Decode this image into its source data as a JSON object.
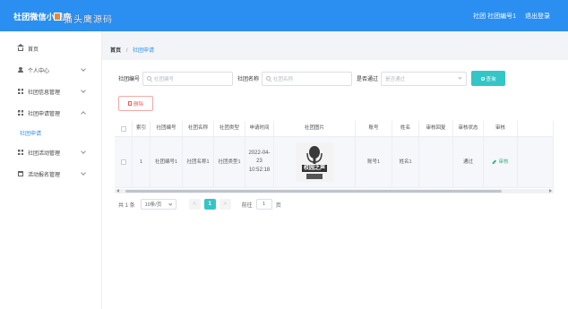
{
  "header": {
    "title": "社团微信小程序",
    "watermark": "猫头鹰源码",
    "user_label": "社团 社团编号1",
    "logout_label": "退出登录"
  },
  "sidebar": {
    "items": [
      {
        "label": "首页",
        "icon": "home-icon"
      },
      {
        "label": "个人中心",
        "icon": "user-icon"
      },
      {
        "label": "社团信息管理",
        "icon": "grid-icon"
      },
      {
        "label": "社团申请管理",
        "icon": "grid-icon"
      },
      {
        "label": "社团申请",
        "icon": ""
      },
      {
        "label": "社团活动管理",
        "icon": "grid-icon"
      },
      {
        "label": "活动报名管理",
        "icon": "calendar-icon"
      }
    ]
  },
  "breadcrumb": {
    "home": "首页",
    "separator": "/",
    "current": "社团申请"
  },
  "search": {
    "club_number_label": "社团编号",
    "club_number_placeholder": "社团编号",
    "club_name_label": "社团名称",
    "club_name_placeholder": "社团名称",
    "approved_label": "是否通过",
    "approved_placeholder": "是否通过",
    "search_button": "查询"
  },
  "actions": {
    "delete_button": "删除"
  },
  "table": {
    "columns": [
      "索引",
      "社团编号",
      "社团名称",
      "社团类型",
      "申请时间",
      "社团图片",
      "账号",
      "姓名",
      "审核回复",
      "审核状态",
      "审核"
    ],
    "rows": [
      {
        "index": "1",
        "club_number": "社团编号1",
        "club_name": "社团名称1",
        "club_type": "社团类型1",
        "apply_time": "2022-04-23 10:52:18",
        "image_caption": "校园之声",
        "account": "账号1",
        "name": "姓名1",
        "reply": "",
        "status": "通过",
        "review_action": "审核"
      }
    ]
  },
  "pagination": {
    "total": "共 1 条",
    "page_size": "10条/页",
    "prev": "<",
    "current_page": "1",
    "next": ">",
    "goto_prefix": "前往",
    "goto_value": "1",
    "goto_suffix": "页"
  },
  "colors": {
    "header_bg": "#2a8ff0",
    "primary_teal": "#34c6c6",
    "danger": "#f05b5b",
    "success": "#36b37e"
  }
}
